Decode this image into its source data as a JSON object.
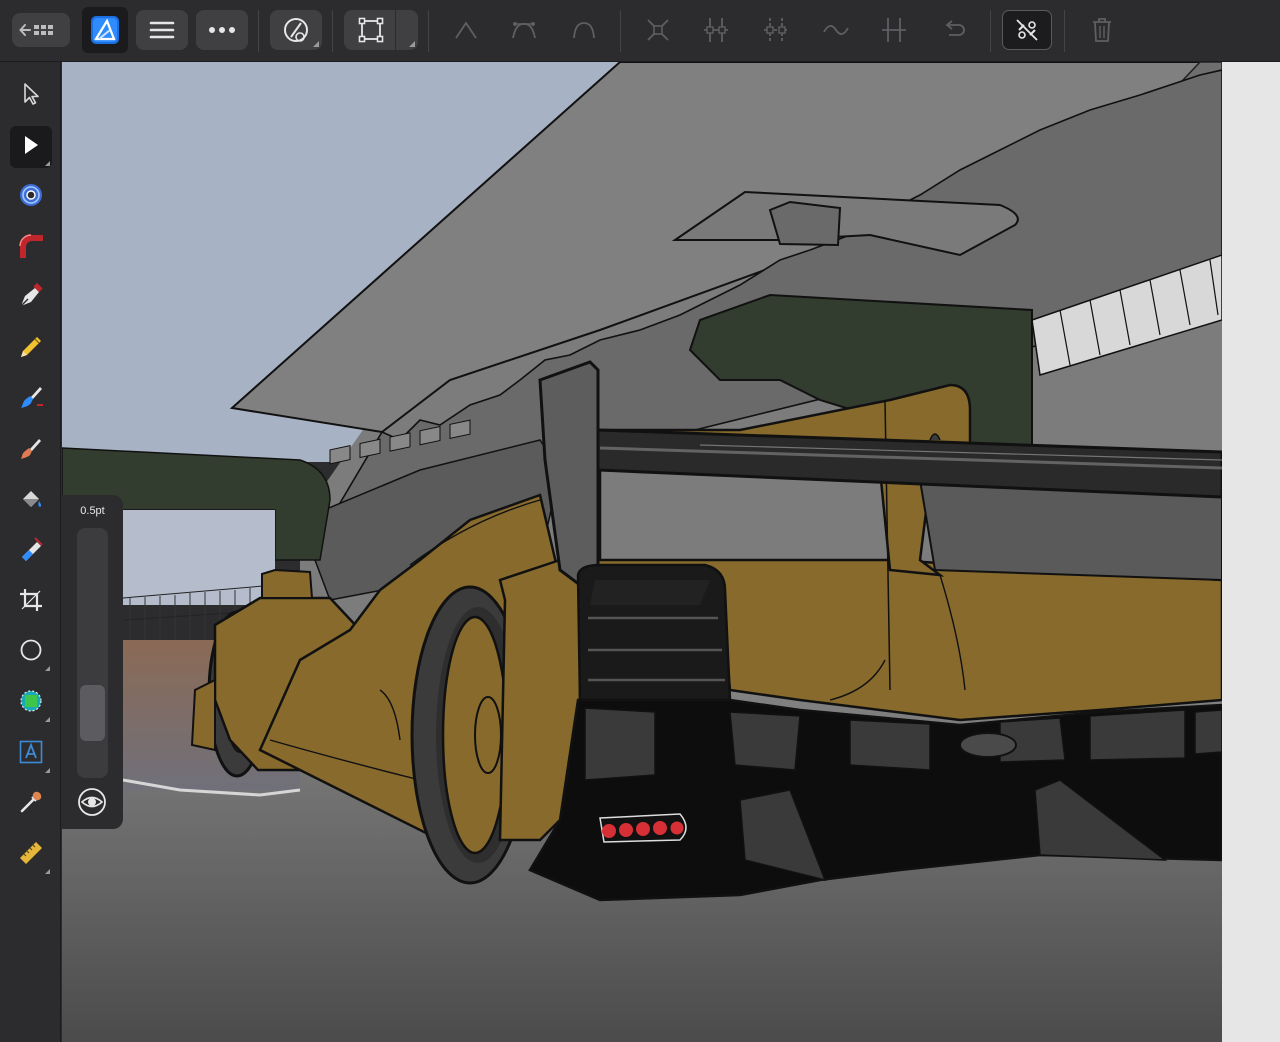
{
  "toolbar": {
    "back_grid_icon": "back-grid-icon",
    "app_logo_icon": "affinity-designer-logo-icon",
    "menu_icon": "hamburger-menu-icon",
    "more_icon": "ellipsis-icon",
    "snapping_icon": "snapping-magnet-icon",
    "transform_icon": "transform-bounding-box-icon",
    "node_tools": [
      "sharp-corner-icon",
      "smooth-node-icon",
      "smart-node-icon",
      "break-curve-icon",
      "join-curves-icon",
      "close-curve-icon",
      "smooth-curve-icon",
      "reverse-curve-icon",
      "undo-node-icon",
      "break-join-icon",
      "delete-icon"
    ]
  },
  "left_tools": [
    {
      "name": "move-tool",
      "icon": "move-arrow-icon"
    },
    {
      "name": "node-tool",
      "icon": "node-arrow-icon",
      "active": true
    },
    {
      "name": "contour-tool",
      "icon": "contour-icon"
    },
    {
      "name": "corner-tool",
      "icon": "corner-icon"
    },
    {
      "name": "pen-tool",
      "icon": "pen-nib-icon"
    },
    {
      "name": "pencil-tool",
      "icon": "pencil-icon"
    },
    {
      "name": "vector-brush-tool",
      "icon": "vector-brush-icon"
    },
    {
      "name": "brush-tool",
      "icon": "brush-icon"
    },
    {
      "name": "fill-tool",
      "icon": "fill-bucket-icon"
    },
    {
      "name": "transparency-tool",
      "icon": "transparency-icon"
    },
    {
      "name": "crop-tool",
      "icon": "crop-icon"
    },
    {
      "name": "ellipse-tool",
      "icon": "ellipse-icon"
    },
    {
      "name": "shape-tool",
      "icon": "shape-icon"
    },
    {
      "name": "text-tool",
      "icon": "text-icon"
    },
    {
      "name": "color-picker-tool",
      "icon": "eyedropper-icon"
    },
    {
      "name": "measure-tool",
      "icon": "ruler-icon"
    }
  ],
  "width_panel": {
    "label": "0.5pt",
    "value_fraction": 0.18
  },
  "colors": {
    "accent": "#2f8cff",
    "chrome": "#2c2c2e",
    "car_body": "#876a2c",
    "sky": "#a7b2c4",
    "canopy": "#7e7e7e",
    "green_foliage": "#333d2f",
    "tail_lights": "#d62f35"
  }
}
